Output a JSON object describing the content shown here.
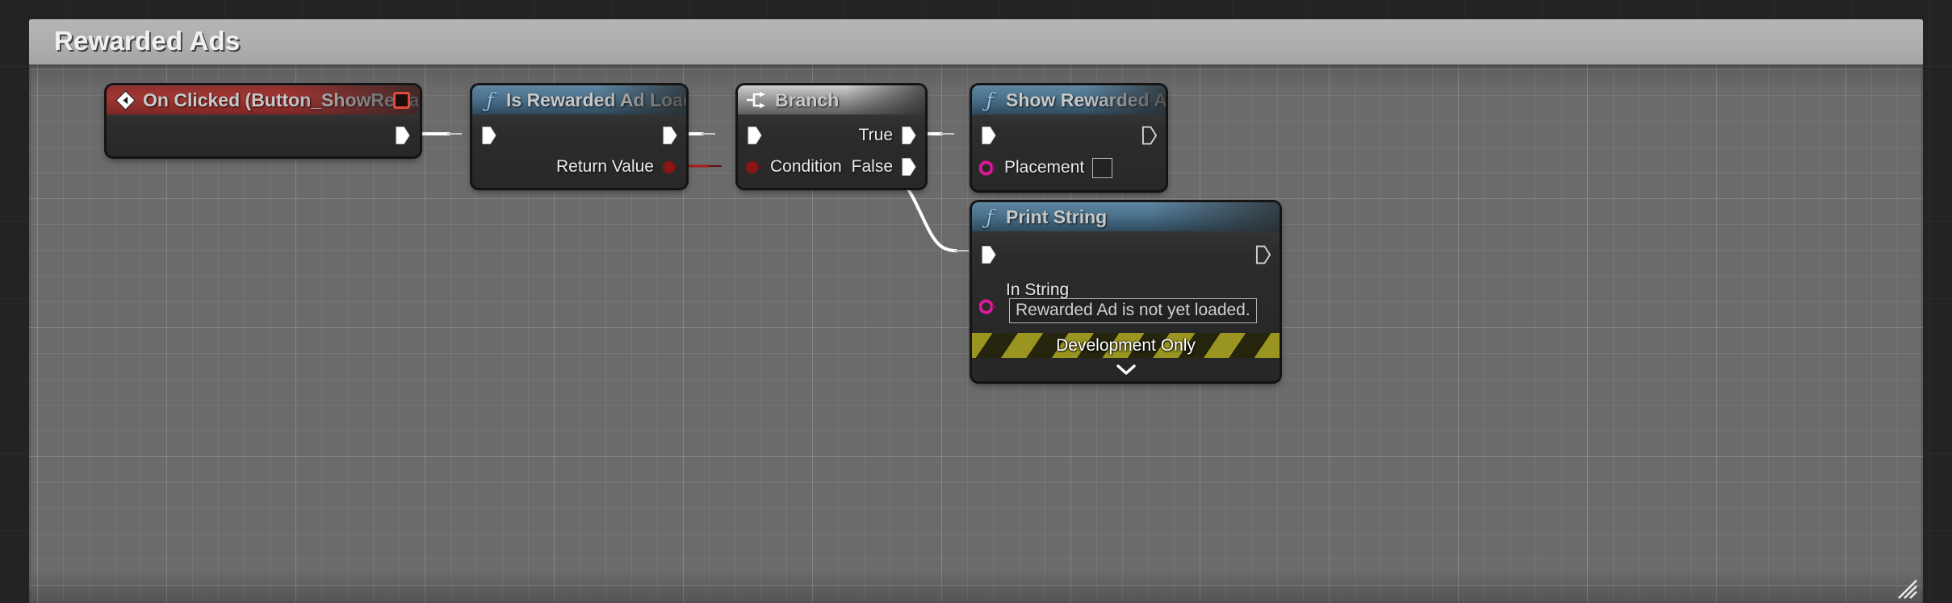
{
  "panel": {
    "title": "Rewarded Ads",
    "resize_grip": "resize-grip"
  },
  "graph": {
    "nodes": [
      {
        "id": "on_clicked",
        "kind": "event",
        "title": "On Clicked (Button_ShowRewardedAd)",
        "icon": "event-diamond-icon",
        "stop_button": "event-breakpoint-button",
        "outputs_exec": [
          ""
        ]
      },
      {
        "id": "is_rewarded_ad_loaded",
        "kind": "function",
        "title": "Is Rewarded Ad Loaded",
        "icon": "function-f-icon",
        "output_data_label": "Return Value"
      },
      {
        "id": "branch",
        "kind": "control",
        "title": "Branch",
        "icon": "branch-icon",
        "input_data_label": "Condition",
        "output_true_label": "True",
        "output_false_label": "False"
      },
      {
        "id": "show_rewarded_ad",
        "kind": "function",
        "title": "Show Rewarded Ad",
        "icon": "function-f-icon",
        "input_data_label": "Placement",
        "input_data_value": ""
      },
      {
        "id": "print_string",
        "kind": "function",
        "title": "Print String",
        "icon": "function-f-icon",
        "input_data_label": "In String",
        "input_data_value": "Rewarded Ad is not yet loaded.",
        "dev_banner": "Development Only",
        "collapse_icon": "chevron-down-icon"
      }
    ],
    "wire_colors": {
      "exec": "#ffffff",
      "boolean": "#a81b1b"
    },
    "pin_colors": {
      "exec": "#ffffff",
      "boolean": "#8b1414",
      "string": "#e0189c"
    },
    "accent_colors": {
      "event_header": "#a03734",
      "function_header": "#4b728c",
      "control_header": "#9d9d9d",
      "dev_banner": "#9a9520",
      "canvas": "#6b6b6b",
      "title_bar": "#adadad"
    }
  }
}
